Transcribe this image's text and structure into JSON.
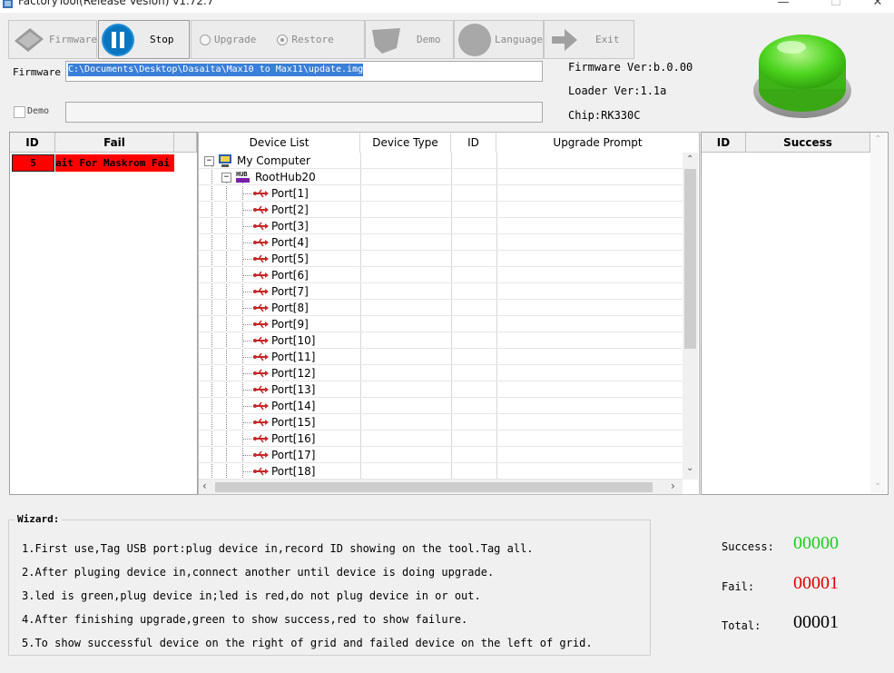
{
  "window": {
    "title": "FactoryTool(Release Vesion) v1.72.7",
    "min_label": "—",
    "max_label": "☐",
    "close_label": "✕"
  },
  "toolbar": {
    "firmware_label": "Firmware",
    "stop_label": "Stop",
    "upgrade_label": "Upgrade",
    "restore_label": "Restore",
    "demo_label": "Demo",
    "language_label": "Language",
    "exit_label": "Exit",
    "mode_selected": "Restore"
  },
  "firmware": {
    "label": "Firmware",
    "path": "C:\\Documents\\Desktop\\Dasaita\\Max10 to Max11\\update.img"
  },
  "demo": {
    "label": "Demo",
    "checked": false,
    "value": ""
  },
  "info": {
    "firmware_ver": "Firmware Ver:b.0.00",
    "loader_ver": "Loader Ver:1.1a",
    "chip": "Chip:RK330C",
    "status_color": "#4cd41e"
  },
  "fail_grid": {
    "headers": [
      "ID",
      "Fail"
    ],
    "rows": [
      {
        "id": "5",
        "text": "ait For Maskrom Fai"
      }
    ],
    "row_color": "#ff0000"
  },
  "device_list": {
    "headers": [
      "Device List",
      "Device Type",
      "ID",
      "Upgrade Prompt"
    ],
    "root": "My Computer",
    "hub": "RootHub20",
    "ports": [
      "Port[1]",
      "Port[2]",
      "Port[3]",
      "Port[4]",
      "Port[5]",
      "Port[6]",
      "Port[7]",
      "Port[8]",
      "Port[9]",
      "Port[10]",
      "Port[11]",
      "Port[12]",
      "Port[13]",
      "Port[14]",
      "Port[15]",
      "Port[16]",
      "Port[17]",
      "Port[18]"
    ]
  },
  "success_grid": {
    "headers": [
      "ID",
      "Success"
    ],
    "rows": []
  },
  "wizard": {
    "title": "Wizard:",
    "lines": [
      "1.First use,Tag USB port:plug device in,record ID showing on the tool.Tag all.",
      "2.After pluging device in,connect another until device is doing upgrade.",
      "3.led is green,plug device in;led is red,do not plug device in or out.",
      "4.After finishing upgrade,green to show success,red to show failure.",
      "5.To show successful device on the right of grid and failed device on the left of grid."
    ]
  },
  "stats": {
    "success_label": "Success:",
    "success_value": "00000",
    "success_color": "#19d119",
    "fail_label": "Fail:",
    "fail_value": "00001",
    "fail_color": "#e00000",
    "total_label": "Total:",
    "total_value": "00001",
    "total_color": "#000000"
  }
}
